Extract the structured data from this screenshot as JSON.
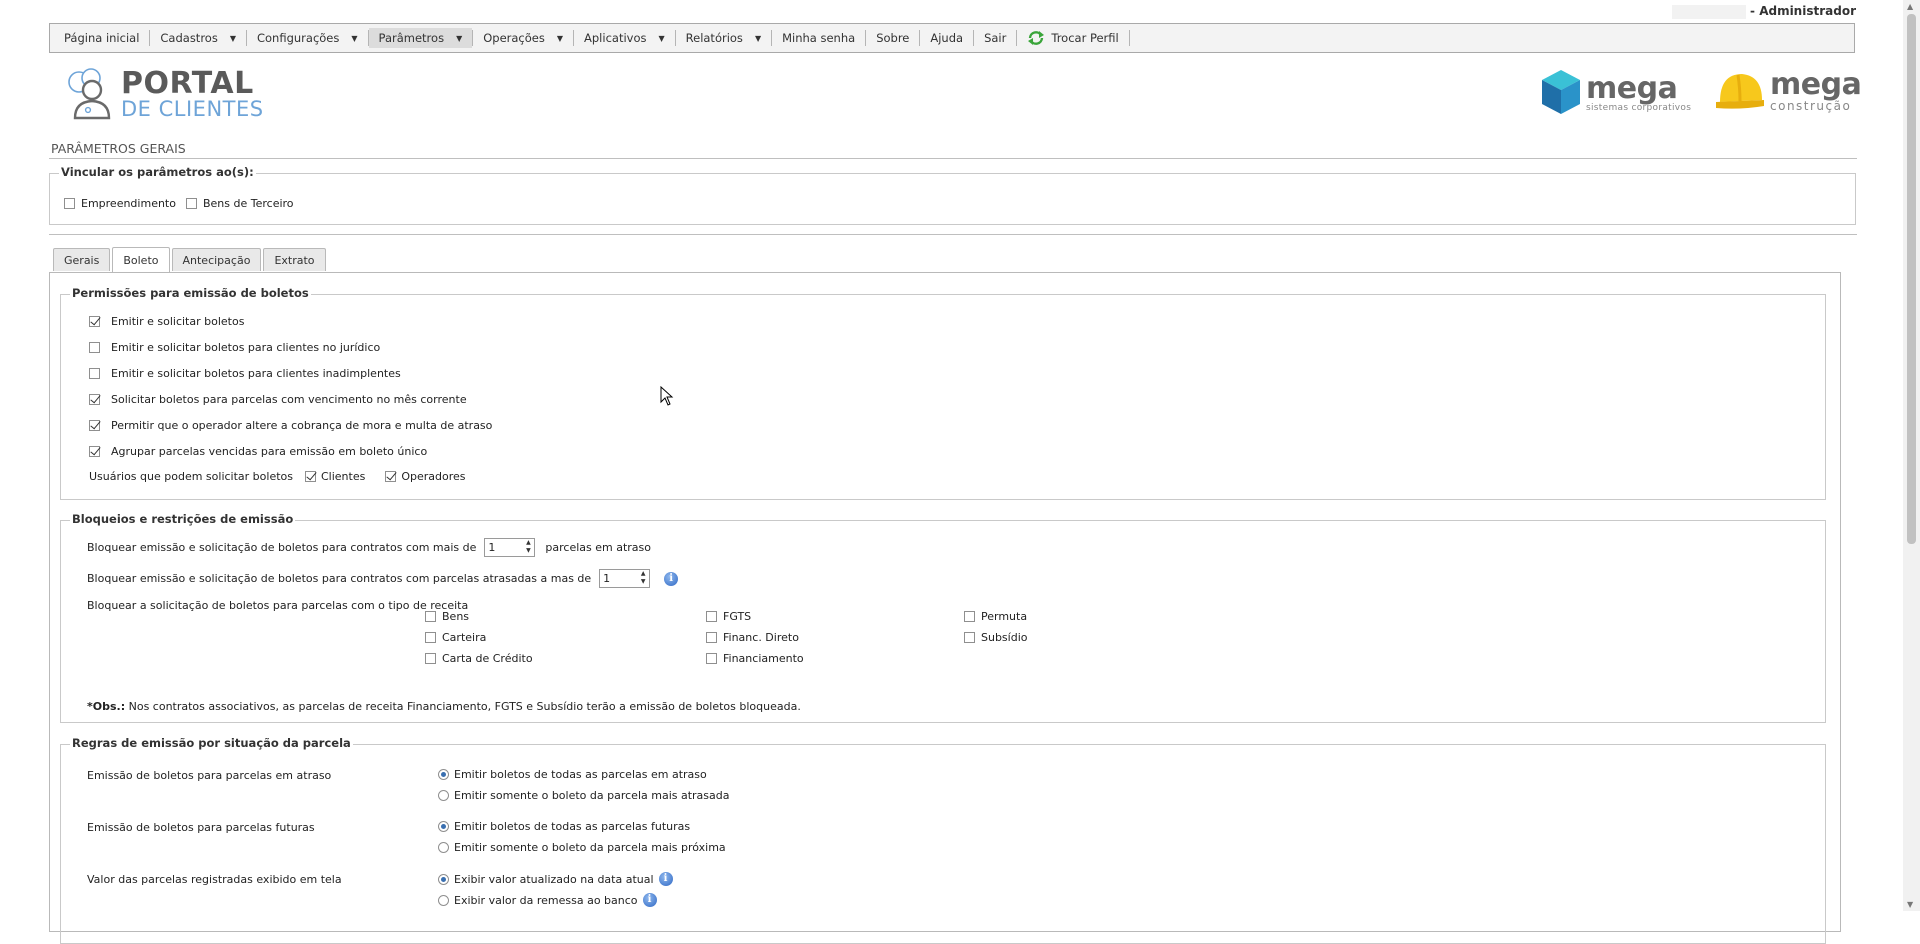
{
  "user": {
    "suffix": "- Administrador"
  },
  "menu": {
    "items": [
      {
        "label": "Página inicial",
        "dropdown": false
      },
      {
        "label": "Cadastros",
        "dropdown": true
      },
      {
        "label": "Configurações",
        "dropdown": true
      },
      {
        "label": "Parâmetros",
        "dropdown": true,
        "active": true
      },
      {
        "label": "Operações",
        "dropdown": true
      },
      {
        "label": "Aplicativos",
        "dropdown": true
      },
      {
        "label": "Relatórios",
        "dropdown": true
      },
      {
        "label": "Minha senha",
        "dropdown": false
      },
      {
        "label": "Sobre",
        "dropdown": false
      },
      {
        "label": "Ajuda",
        "dropdown": false
      },
      {
        "label": "Sair",
        "dropdown": false
      }
    ],
    "trocar_perfil": "Trocar Perfil"
  },
  "logos": {
    "portal_line1": "PORTAL",
    "portal_line2": "DE CLIENTES",
    "mega1_name": "mega",
    "mega1_sub": "sistemas corporativos",
    "mega2_name": "mega",
    "mega2_sub": "construção"
  },
  "page": {
    "title": "PARÂMETROS GERAIS"
  },
  "vincular": {
    "legend": "Vincular os parâmetros ao(s):",
    "empreendimento": "Empreendimento",
    "bens_terceiro": "Bens de Terceiro"
  },
  "tabs": {
    "gerais": "Gerais",
    "boleto": "Boleto",
    "antecipacao": "Antecipação",
    "extrato": "Extrato"
  },
  "permissoes": {
    "legend": "Permissões para emissão de boletos",
    "items": [
      {
        "label": "Emitir e solicitar boletos",
        "checked": true
      },
      {
        "label": "Emitir e solicitar boletos para clientes no jurídico",
        "checked": false
      },
      {
        "label": "Emitir e solicitar boletos para clientes inadimplentes",
        "checked": false
      },
      {
        "label": "Solicitar boletos para parcelas com vencimento no mês corrente",
        "checked": true
      },
      {
        "label": "Permitir que o operador altere a cobrança de mora e multa de atraso",
        "checked": true
      },
      {
        "label": "Agrupar parcelas vencidas para emissão em boleto único",
        "checked": true
      }
    ],
    "usuarios_label": "Usuários que podem solicitar boletos",
    "clientes": "Clientes",
    "operadores": "Operadores"
  },
  "bloqueios": {
    "legend": "Bloqueios e restrições de emissão",
    "row1_prefix": "Bloquear emissão e solicitação de boletos para contratos com mais de",
    "row1_value": "1",
    "row1_suffix": "parcelas em atraso",
    "row2_prefix": "Bloquear emissão e solicitação de boletos para contratos com parcelas atrasadas a mas de",
    "row2_value": "1",
    "row3_label": "Bloquear a solicitação de boletos para parcelas com o tipo de receita",
    "receitas": [
      "Bens",
      "Carteira",
      "Carta de Crédito",
      "FGTS",
      "Financ. Direto",
      "Financiamento",
      "Permuta",
      "Subsídio"
    ],
    "obs_bold": "*Obs.:",
    "obs_text": " Nos contratos associativos, as parcelas de receita Financiamento, FGTS e Subsídio terão a emissão de boletos bloqueada."
  },
  "regras": {
    "legend": "Regras de emissão por situação da parcela",
    "atraso_label": "Emissão de boletos para parcelas em atraso",
    "atraso_opt1": "Emitir boletos de todas as parcelas em atraso",
    "atraso_opt2": "Emitir somente o boleto da parcela mais atrasada",
    "futuras_label": "Emissão de boletos para parcelas futuras",
    "futuras_opt1": "Emitir boletos de todas as parcelas futuras",
    "futuras_opt2": "Emitir somente o boleto da parcela mais próxima",
    "valor_label": "Valor das parcelas registradas exibido em tela",
    "valor_opt1": "Exibir valor atualizado na data atual",
    "valor_opt2": "Exibir valor da remessa ao banco"
  }
}
